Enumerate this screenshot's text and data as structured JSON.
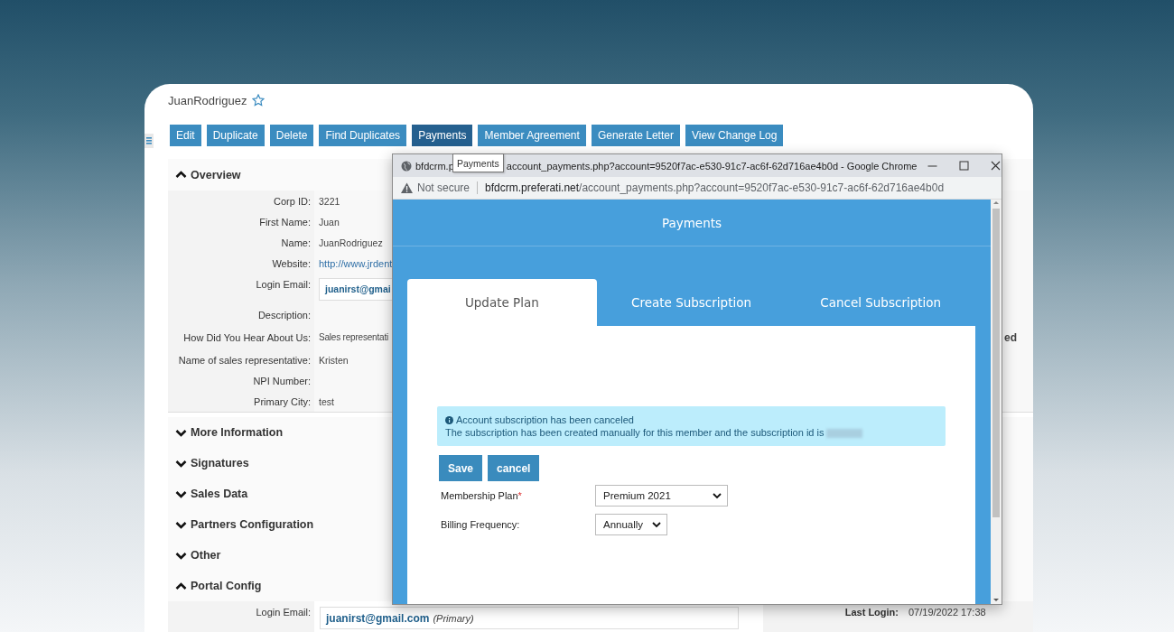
{
  "record": {
    "title": "JuanRodriguez"
  },
  "toolbar": [
    {
      "label": "Edit",
      "selected": false
    },
    {
      "label": "Duplicate",
      "selected": false
    },
    {
      "label": "Delete",
      "selected": false
    },
    {
      "label": "Find Duplicates",
      "selected": false
    },
    {
      "label": "Payments",
      "selected": true
    },
    {
      "label": "Member Agreement",
      "selected": false
    },
    {
      "label": "Generate Letter",
      "selected": false
    },
    {
      "label": "View Change Log",
      "selected": false
    }
  ],
  "sections": [
    {
      "title": "Overview",
      "expanded": true,
      "fields": [
        {
          "label": "Corp ID:",
          "kind": "text",
          "value": "3221"
        },
        {
          "label": "First Name:",
          "kind": "text",
          "value": "Juan"
        },
        {
          "label": "Name:",
          "kind": "text",
          "value": "JuanRodriguez"
        },
        {
          "label": "Website:",
          "kind": "link",
          "value": "http://www.jrdent"
        },
        {
          "label": "Login Email:",
          "kind": "email",
          "value": "juanirst@gmai"
        },
        {
          "label": "Description:",
          "kind": "text"
        },
        {
          "label": "How Did You Hear About Us:",
          "kind": "text",
          "value": "Sales representati",
          "side_value": "ed"
        },
        {
          "label": "Name of sales representative:",
          "kind": "text",
          "value": "Kristen"
        },
        {
          "label": "NPI Number:",
          "kind": "text"
        },
        {
          "label": "Primary City:",
          "kind": "text",
          "value": "test"
        }
      ]
    },
    {
      "title": "More Information",
      "expanded": false
    },
    {
      "title": "Signatures",
      "expanded": false
    },
    {
      "title": "Sales Data",
      "expanded": false
    },
    {
      "title": "Partners Configuration",
      "expanded": false
    },
    {
      "title": "Other",
      "expanded": false
    },
    {
      "title": "Portal Config",
      "expanded": true,
      "fields": [
        {
          "label": "Login Email:",
          "kind": "email",
          "value": "juanirst@gmail.com",
          "tag": "(Primary)",
          "side_label": "Last Login:",
          "side_value": "07/19/2022 17:38"
        }
      ]
    }
  ],
  "popup": {
    "title_start": "bfdcrm.p",
    "title_end": "account_payments.php?account=9520f7ac-e530-91c7-ac6f-62d716ae4b0d - Google Chrome",
    "tooltip": "Payments",
    "security": "Not secure",
    "url_host": "bfdcrm.preferati.net",
    "url_path": "/account_payments.php?account=9520f7ac-e530-91c7-ac6f-62d716ae4b0d",
    "heading": "Payments",
    "tabs": [
      {
        "label": "Update Plan",
        "selected": true
      },
      {
        "label": "Create Subscription",
        "selected": false
      },
      {
        "label": "Cancel Subscription",
        "selected": false
      }
    ],
    "alert": {
      "title": "Account subscription has been canceled",
      "message": "The subscription has been created manually for this member and the subscription id is"
    },
    "buttons": [
      "Save",
      "cancel"
    ],
    "form": [
      {
        "label": "Membership Plan",
        "required_mark": "*",
        "value": "Premium 2021"
      },
      {
        "label": "Billing Frequency:",
        "value": "Annually"
      }
    ]
  }
}
